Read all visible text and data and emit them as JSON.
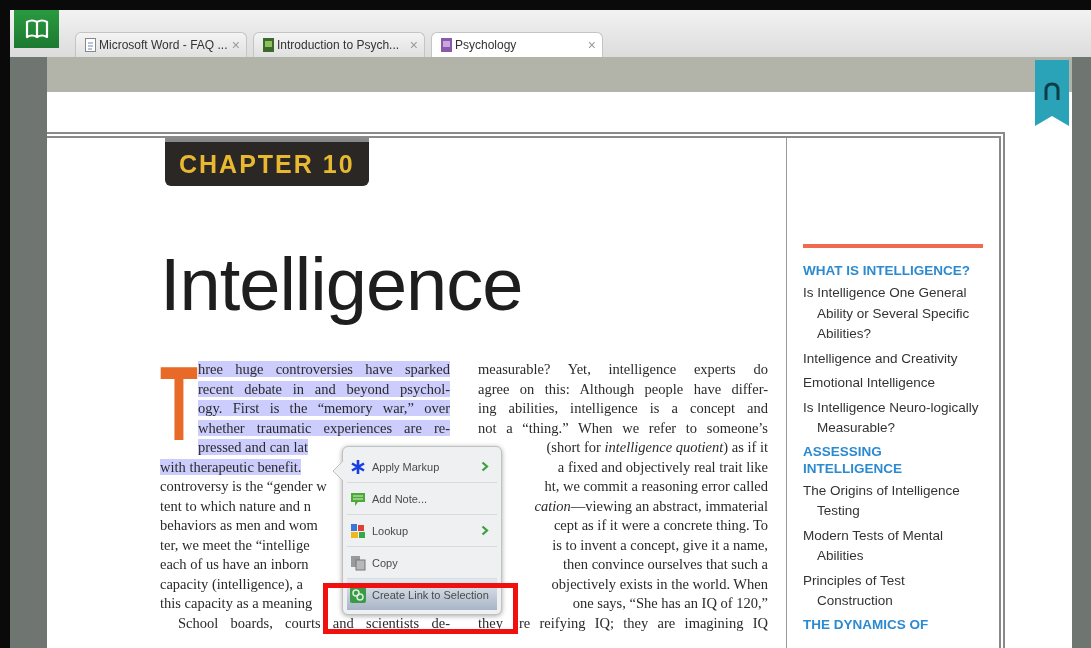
{
  "tabs": [
    {
      "title": "Microsoft Word - FAQ ...",
      "kind": "document",
      "selected": false,
      "close": "×"
    },
    {
      "title": "Introduction to Psych...",
      "kind": "book",
      "selected": false,
      "close": "×"
    },
    {
      "title": "Psychology",
      "kind": "book",
      "selected": true,
      "close": "×"
    }
  ],
  "chapter_label": "CHAPTER 10",
  "title": "Intelligence",
  "drop_cap": "T",
  "left_column": [
    {
      "text": "hree huge controversies have sparked",
      "kind": "full",
      "highlighted": true
    },
    {
      "text": "recent debate in and beyond psychol-",
      "kind": "full",
      "highlighted": true
    },
    {
      "text": "ogy. First is the “memory war,” over",
      "kind": "full",
      "highlighted": true
    },
    {
      "text": "whether traumatic experiences are re-",
      "kind": "full",
      "highlighted": true
    },
    {
      "text": "pressed and can lat",
      "kind": "cut_end",
      "highlighted": true
    },
    {
      "text": "with therapeutic benefit.",
      "kind": "cut_end",
      "highlighted": true
    },
    {
      "text": "controversy is the “gender w",
      "kind": "cut_end",
      "highlighted": false
    },
    {
      "text": "tent to which nature and n",
      "kind": "cut_end",
      "highlighted": false
    },
    {
      "text": "behaviors as men and wom",
      "kind": "cut_end",
      "highlighted": false
    },
    {
      "text": "ter, we meet the “intellige",
      "kind": "cut_end",
      "highlighted": false
    },
    {
      "text": "each of us have an inborn",
      "kind": "cut_end",
      "highlighted": false
    },
    {
      "text": "capacity (intelligence), a",
      "kind": "cut_end",
      "highlighted": false
    },
    {
      "text": "this capacity as a meaning",
      "kind": "cut_end",
      "highlighted": false
    },
    {
      "text": "School boards, courts and scientists de-",
      "kind": "first",
      "highlighted": false
    }
  ],
  "right_column": [
    {
      "text": "measurable? Yet, intelligence experts do",
      "kind": "full"
    },
    {
      "text": "agree on this: Although people have differ-",
      "kind": "full"
    },
    {
      "text": "ing abilities, intelligence is a concept and",
      "kind": "full"
    },
    {
      "text": "not a “thing.” When we refer to someone’s",
      "kind": "full"
    },
    {
      "text": "(short for *intelligence quotient*) as if it",
      "kind": "cut_start"
    },
    {
      "text": "a fixed and objectively real trait like",
      "kind": "cut_start"
    },
    {
      "text": "ht, we commit a reasoning error called",
      "kind": "cut_start"
    },
    {
      "text": "*cation*—viewing an abstract, immaterial",
      "kind": "cut_start"
    },
    {
      "text": "cept as if it were a concrete thing. To",
      "kind": "cut_start"
    },
    {
      "text": "is to invent a concept, give it a name,",
      "kind": "cut_start"
    },
    {
      "text": "then convince ourselves that such a",
      "kind": "cut_start"
    },
    {
      "text": "objectively exists in the world. When",
      "kind": "cut_start"
    },
    {
      "text": "one says, “She has an IQ of 120,”",
      "kind": "cut_start"
    },
    {
      "lead": "they",
      "text": "re reifying IQ; they are imagining IQ",
      "kind": "full"
    }
  ],
  "sidebar": [
    {
      "heading": "WHAT IS INTELLIGENCE?",
      "items": [
        "Is Intelligence One General Ability or Several Specific Abilities?",
        "Intelligence and Creativity",
        "Emotional Intelligence",
        "Is Intelligence Neuro-logically Measurable?"
      ]
    },
    {
      "heading": "ASSESSING INTELLIGENCE",
      "items": [
        "The Origins of Intelligence Testing",
        "Modern Tests of Mental Abilities",
        "Principles of Test Construction"
      ]
    },
    {
      "heading": "THE DYNAMICS OF"
    }
  ],
  "context_menu": [
    {
      "label": "Apply Markup",
      "kind": "markup",
      "submenu": true,
      "selected": false
    },
    {
      "label": "Add Note...",
      "kind": "note",
      "submenu": false,
      "selected": false
    },
    {
      "label": "Lookup",
      "kind": "lookup",
      "submenu": true,
      "selected": false
    },
    {
      "label": "Copy",
      "kind": "copy",
      "submenu": false,
      "selected": false
    },
    {
      "label": "Create Link to Selection",
      "kind": "link",
      "submenu": false,
      "selected": true
    }
  ]
}
